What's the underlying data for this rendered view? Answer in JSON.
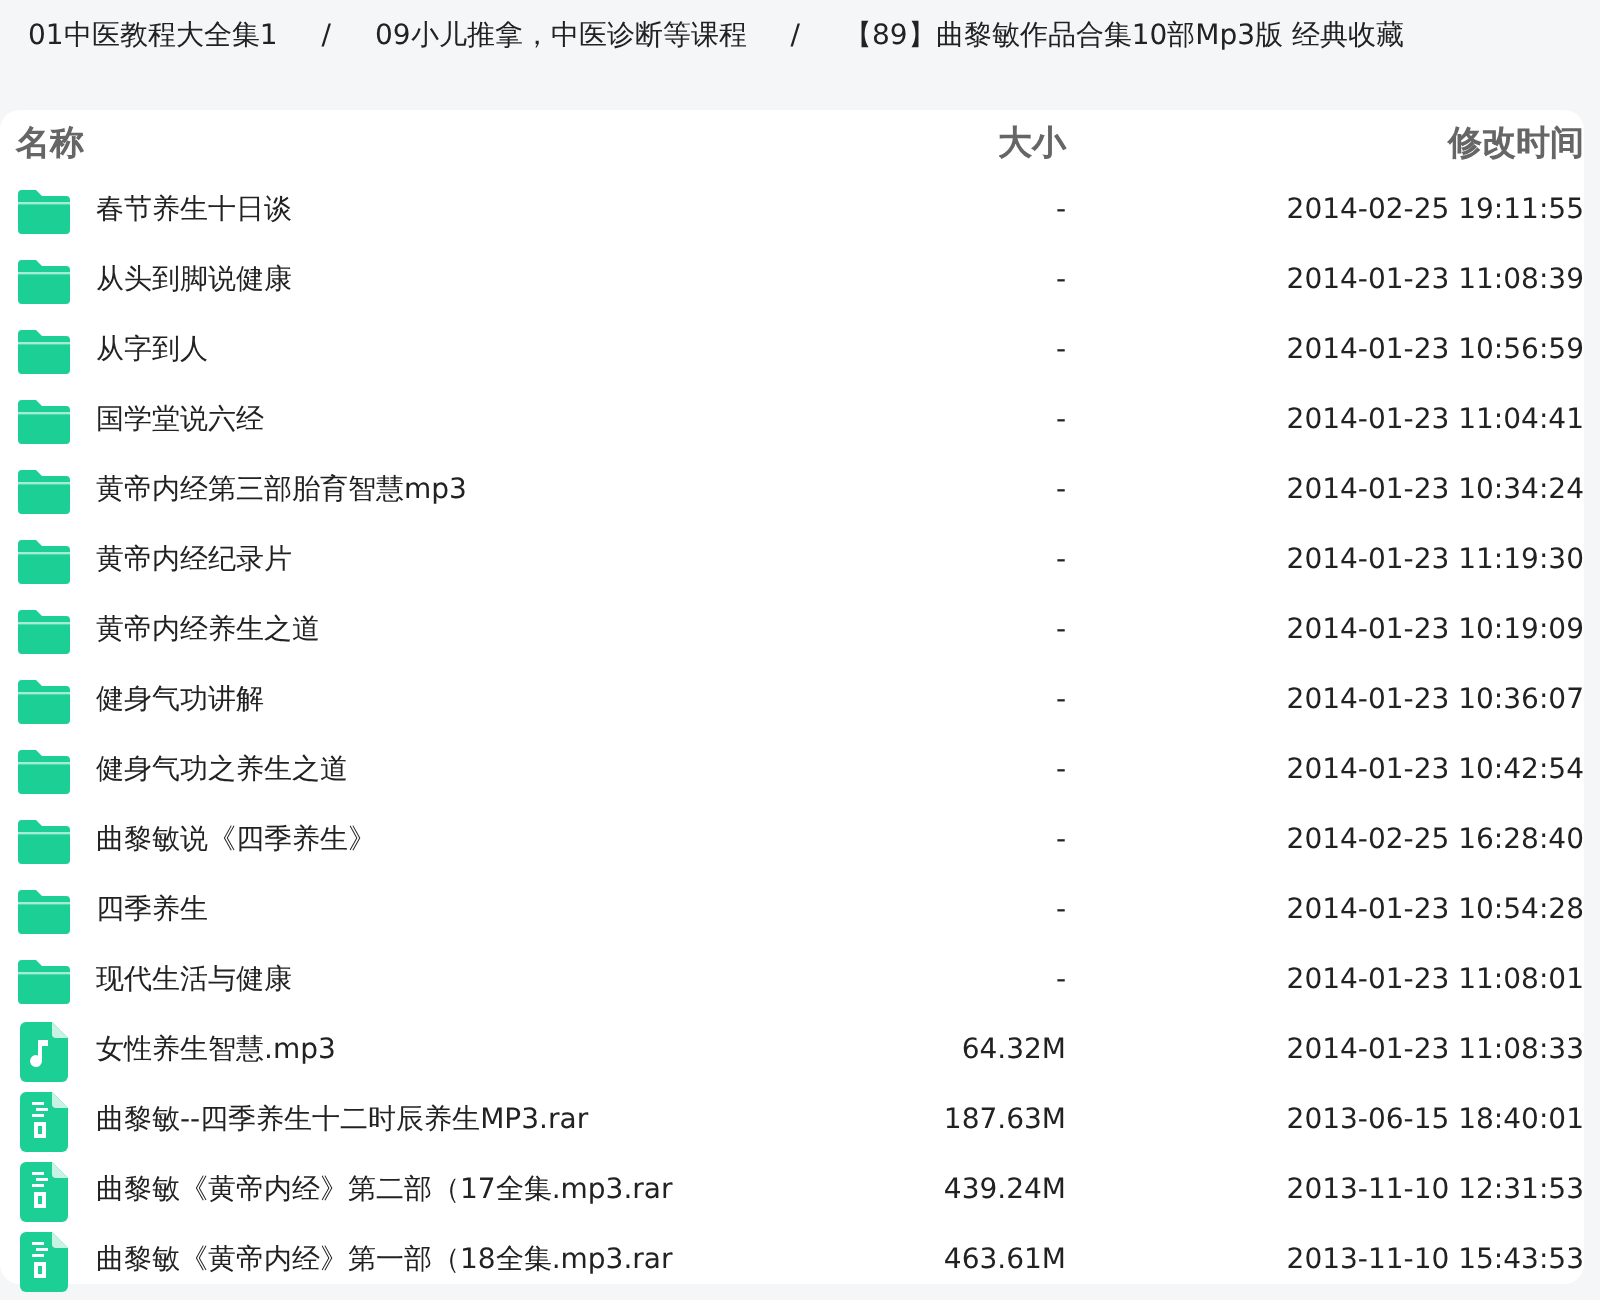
{
  "breadcrumb": [
    {
      "kind": "link",
      "text": "01中医教程大全集1"
    },
    {
      "kind": "separator",
      "text": "/"
    },
    {
      "kind": "link",
      "text": "09小儿推拿，中医诊断等课程"
    },
    {
      "kind": "separator",
      "text": "/"
    },
    {
      "kind": "current",
      "text": "【89】曲黎敏作品合集10部Mp3版 经典收藏"
    }
  ],
  "table": {
    "columns": [
      "名称",
      "大小",
      "修改时间"
    ],
    "rows": [
      {
        "kind": "folder",
        "name": "春节养生十日谈",
        "size": "-",
        "modified": "2014-02-25 19:11:55"
      },
      {
        "kind": "folder",
        "name": "从头到脚说健康",
        "size": "-",
        "modified": "2014-01-23 11:08:39"
      },
      {
        "kind": "folder",
        "name": "从字到人",
        "size": "-",
        "modified": "2014-01-23 10:56:59"
      },
      {
        "kind": "folder",
        "name": "国学堂说六经",
        "size": "-",
        "modified": "2014-01-23 11:04:41"
      },
      {
        "kind": "folder",
        "name": "黄帝内经第三部胎育智慧mp3",
        "size": "-",
        "modified": "2014-01-23 10:34:24"
      },
      {
        "kind": "folder",
        "name": "黄帝内经纪录片",
        "size": "-",
        "modified": "2014-01-23 11:19:30"
      },
      {
        "kind": "folder",
        "name": "黄帝内经养生之道",
        "size": "-",
        "modified": "2014-01-23 10:19:09"
      },
      {
        "kind": "folder",
        "name": "健身气功讲解",
        "size": "-",
        "modified": "2014-01-23 10:36:07"
      },
      {
        "kind": "folder",
        "name": "健身气功之养生之道",
        "size": "-",
        "modified": "2014-01-23 10:42:54"
      },
      {
        "kind": "folder",
        "name": "曲黎敏说《四季养生》",
        "size": "-",
        "modified": "2014-02-25 16:28:40"
      },
      {
        "kind": "folder",
        "name": "四季养生",
        "size": "-",
        "modified": "2014-01-23 10:54:28"
      },
      {
        "kind": "folder",
        "name": "现代生活与健康",
        "size": "-",
        "modified": "2014-01-23 11:08:01"
      },
      {
        "kind": "audio",
        "name": "女性养生智慧.mp3",
        "size": "64.32M",
        "modified": "2014-01-23 11:08:33"
      },
      {
        "kind": "archive",
        "name": "曲黎敏--四季养生十二时辰养生MP3.rar",
        "size": "187.63M",
        "modified": "2013-06-15 18:40:01"
      },
      {
        "kind": "archive",
        "name": "曲黎敏《黄帝内经》第二部（17全集.mp3.rar",
        "size": "439.24M",
        "modified": "2013-11-10 12:31:53"
      },
      {
        "kind": "archive",
        "name": "曲黎敏《黄帝内经》第一部（18全集.mp3.rar",
        "size": "463.61M",
        "modified": "2013-11-10 15:43:53"
      }
    ]
  }
}
